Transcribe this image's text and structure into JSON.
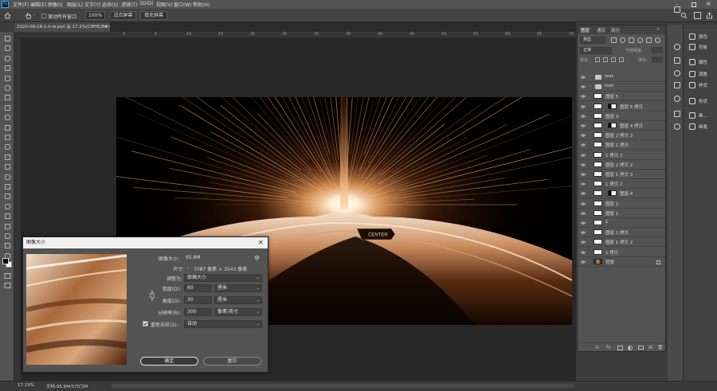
{
  "menubar": {
    "app_icon": "Ps",
    "items": [
      "文件(F)",
      "编辑(E)",
      "图像(I)",
      "图层(L)",
      "文字(Y)",
      "选择(S)",
      "滤镜(T)",
      "3D(D)",
      "视图(V)",
      "窗口(W)",
      "帮助(H)"
    ]
  },
  "options": {
    "scroll_all_label": "滚动所有窗口",
    "zoom_value": "100%",
    "fit_screen_label": "适合屏幕",
    "fill_screen_label": "填充屏幕"
  },
  "document": {
    "tab_title": "2020-08-16-1-h-w.psd @ 17.2%(CMYK/8#)",
    "close_glyph": "×"
  },
  "ruler": {
    "marks": [
      "0",
      "5",
      "10",
      "15",
      "20",
      "25",
      "30",
      "35",
      "40",
      "45",
      "50",
      "55",
      "60",
      "65",
      "70"
    ]
  },
  "artwork": {
    "center_label": "CENTER"
  },
  "status": {
    "zoom": "17.19%",
    "doc_info": "文档:95.8M/570.3M"
  },
  "dialog": {
    "title": "图像大小",
    "image_size_label": "图像大小:",
    "image_size_value": "95.8M",
    "dimensions_label": "尺寸:",
    "dimensions_value": "7087 像素 × 3543 像素",
    "fit_label": "调整为:",
    "fit_value": "原稿大小",
    "width_label": "宽度(D):",
    "width_value": "60",
    "width_unit": "厘米",
    "height_label": "高度(G):",
    "height_value": "30",
    "height_unit": "厘米",
    "resolution_label": "分辨率(R):",
    "resolution_value": "300",
    "resolution_unit": "像素/英寸",
    "resample_label": "重新采样(S):",
    "resample_value": "自动",
    "ok_label": "确定",
    "reset_label": "复位",
    "resample_checked": true
  },
  "layers_panel": {
    "tabs": [
      "图层",
      "通道",
      "路径"
    ],
    "kind_filter": "类型",
    "blend_mode": "正常",
    "opacity_label": "不透明度:",
    "fill_label": "填充:",
    "lock_label": "锁定:",
    "layers": [
      {
        "name": "text",
        "kind": "folder"
      },
      {
        "name": "icon",
        "kind": "folder"
      },
      {
        "name": "图层 5",
        "kind": "layer"
      },
      {
        "name": "图层 5 拷贝",
        "kind": "masked"
      },
      {
        "name": "图层 3",
        "kind": "layer"
      },
      {
        "name": "图层 4 拷贝",
        "kind": "masked"
      },
      {
        "name": "图层 2 拷贝 2",
        "kind": "layer"
      },
      {
        "name": "图层 1 拷贝",
        "kind": "layer"
      },
      {
        "name": "1 拷贝 2",
        "kind": "layer"
      },
      {
        "name": "图层 2 拷贝 2",
        "kind": "layer"
      },
      {
        "name": "图层 1 拷贝 3",
        "kind": "layer"
      },
      {
        "name": "1 拷贝 2",
        "kind": "layer"
      },
      {
        "name": "图层 4",
        "kind": "masked"
      },
      {
        "name": "图层 2",
        "kind": "layer"
      },
      {
        "name": "图层 1",
        "kind": "layer"
      },
      {
        "name": "1",
        "kind": "layer"
      },
      {
        "name": "图层 2 拷贝",
        "kind": "layer"
      },
      {
        "name": "图层 1 拷贝 2",
        "kind": "layer"
      },
      {
        "name": "1 拷贝",
        "kind": "layer"
      },
      {
        "name": "背景",
        "kind": "background"
      }
    ]
  },
  "dock": {
    "groups": [
      {
        "items": [
          {
            "label": "颜色",
            "icon": "color-icon"
          },
          {
            "label": "色板",
            "icon": "swatches-icon"
          }
        ]
      },
      {
        "items": [
          {
            "label": "属性",
            "icon": "properties-icon"
          },
          {
            "label": "调整",
            "icon": "adjustments-icon"
          },
          {
            "label": "样式",
            "icon": "styles-icon"
          }
        ]
      },
      {
        "items": [
          {
            "label": "形状",
            "icon": "shapes-icon"
          }
        ]
      },
      {
        "items": [
          {
            "label": "画...",
            "icon": "brush-icon"
          },
          {
            "label": "画笔",
            "icon": "brushes-icon"
          }
        ]
      }
    ]
  },
  "colors": {
    "accent": "#1473e6",
    "panel": "#535353",
    "workspace": "#282828"
  }
}
